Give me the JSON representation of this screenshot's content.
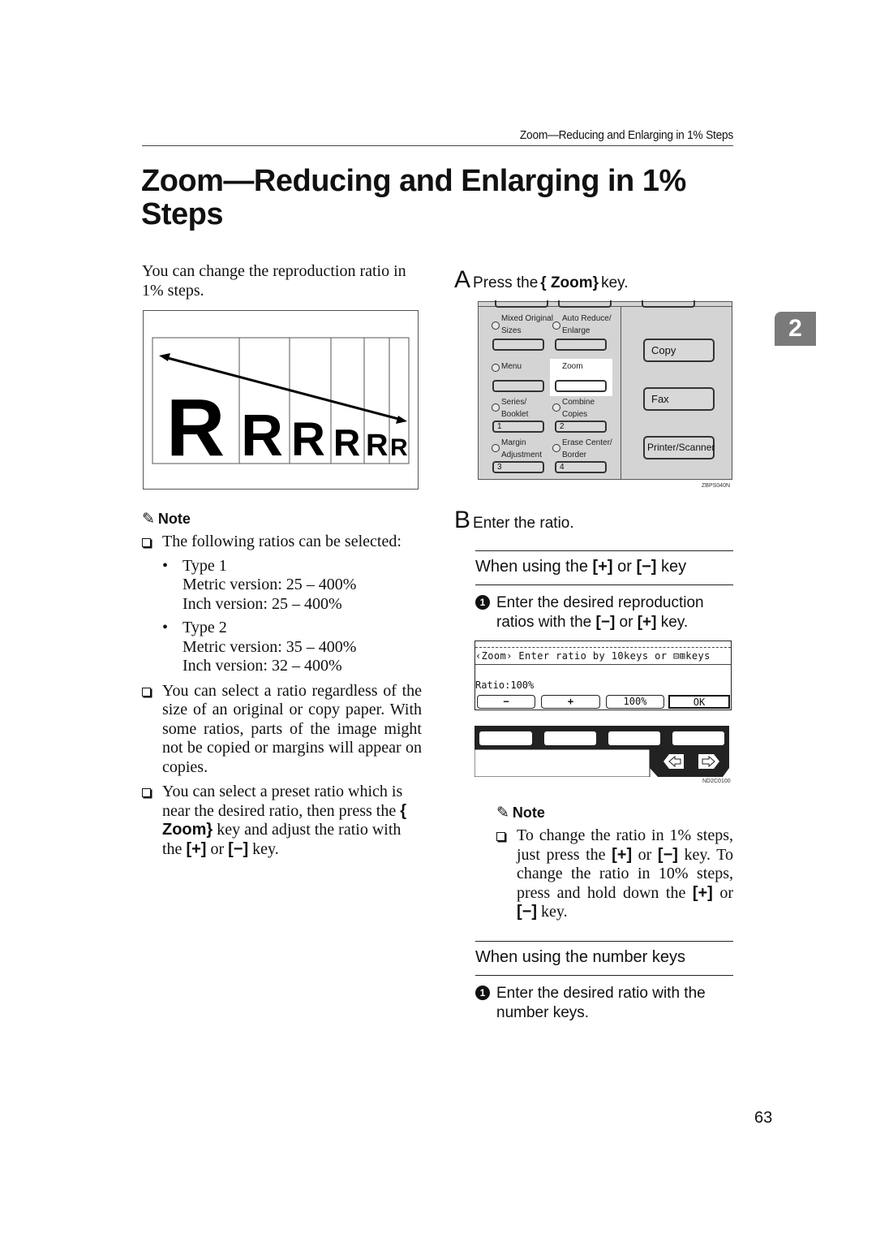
{
  "running_header": "Zoom—Reducing and Enlarging in 1% Steps",
  "title": "Zoom—Reducing and Enlarging in 1% Steps",
  "intro": "You can change the reproduction ratio in 1% steps.",
  "diagram": {
    "glyph": "R",
    "cells": 6
  },
  "left_note": {
    "heading": "Note",
    "items": [
      {
        "text": "The following ratios can be selected:",
        "bullets": [
          {
            "type": "Type 1",
            "metric": "Metric version: 25 – 400%",
            "inch": "Inch version: 25 – 400%"
          },
          {
            "type": "Type 2",
            "metric": "Metric version: 35 – 400%",
            "inch": "Inch version: 32 – 400%"
          }
        ]
      },
      {
        "text": "You can select a ratio regardless of the size of an original or copy paper. With some ratios, parts of the image might not be copied or margins will appear on copies."
      },
      {
        "text_before": "You can select a preset ratio which is near the desired ratio, then press the",
        "key_zoom": "{ Zoom}",
        "text_mid": "key and adjust the ratio with the",
        "key_plus": "[+]",
        "text_or": "or",
        "key_minus": "[−]",
        "text_after": "key."
      }
    ]
  },
  "step_a": {
    "letter": "A",
    "text_before": "Press the",
    "key": "{ Zoom}",
    "text_after": "key."
  },
  "panel": {
    "left_keys": [
      {
        "label": "Mixed Original Sizes",
        "key": ""
      },
      {
        "label": "Auto Reduce/ Enlarge",
        "key": ""
      },
      {
        "label": "Menu",
        "key": ""
      },
      {
        "label": "Zoom",
        "key": "",
        "highlighted": true
      },
      {
        "label": "Series/ Booklet",
        "key": "1"
      },
      {
        "label": "Combine Copies",
        "key": "2"
      },
      {
        "label": "Margin Adjustment",
        "key": "3"
      },
      {
        "label": "Erase Center/ Border",
        "key": "4"
      }
    ],
    "mode_keys": [
      "Copy",
      "Fax",
      "Printer/Scanner"
    ],
    "caption": "ZBPS040N"
  },
  "step_b": {
    "letter": "B",
    "text": "Enter the ratio."
  },
  "subsection_plus_minus": {
    "heading_before": "When using the",
    "key_plus": "[+]",
    "heading_or": "or",
    "key_minus": "[−]",
    "heading_after": "key",
    "step_num": "1",
    "step_before": "Enter the desired reproduction ratios with the",
    "step_key_minus": "[−]",
    "step_or": "or",
    "step_key_plus": "[+]",
    "step_after": "key."
  },
  "lcd": {
    "message": "‹Zoom› Enter ratio by 10keys or ⊟⊞keys",
    "ratio": "Ratio:100%",
    "buttons": [
      "−",
      "+",
      "100%",
      "OK"
    ],
    "caption": "ND2C0100"
  },
  "right_note": {
    "heading": "Note",
    "before": "To change the ratio in 1% steps, just press the",
    "key_plus": "[+]",
    "or1": "or",
    "key_minus": "[−]",
    "mid": "key. To change the ratio in 10% steps, press and hold down the",
    "key_plus2": "[+]",
    "or2": "or",
    "key_minus2": "[−]",
    "after": "key."
  },
  "subsection_number_keys": {
    "heading": "When using the number keys",
    "step_num": "1",
    "step": "Enter the desired ratio with the number keys."
  },
  "chapter_tab": "2",
  "page_number": "63"
}
